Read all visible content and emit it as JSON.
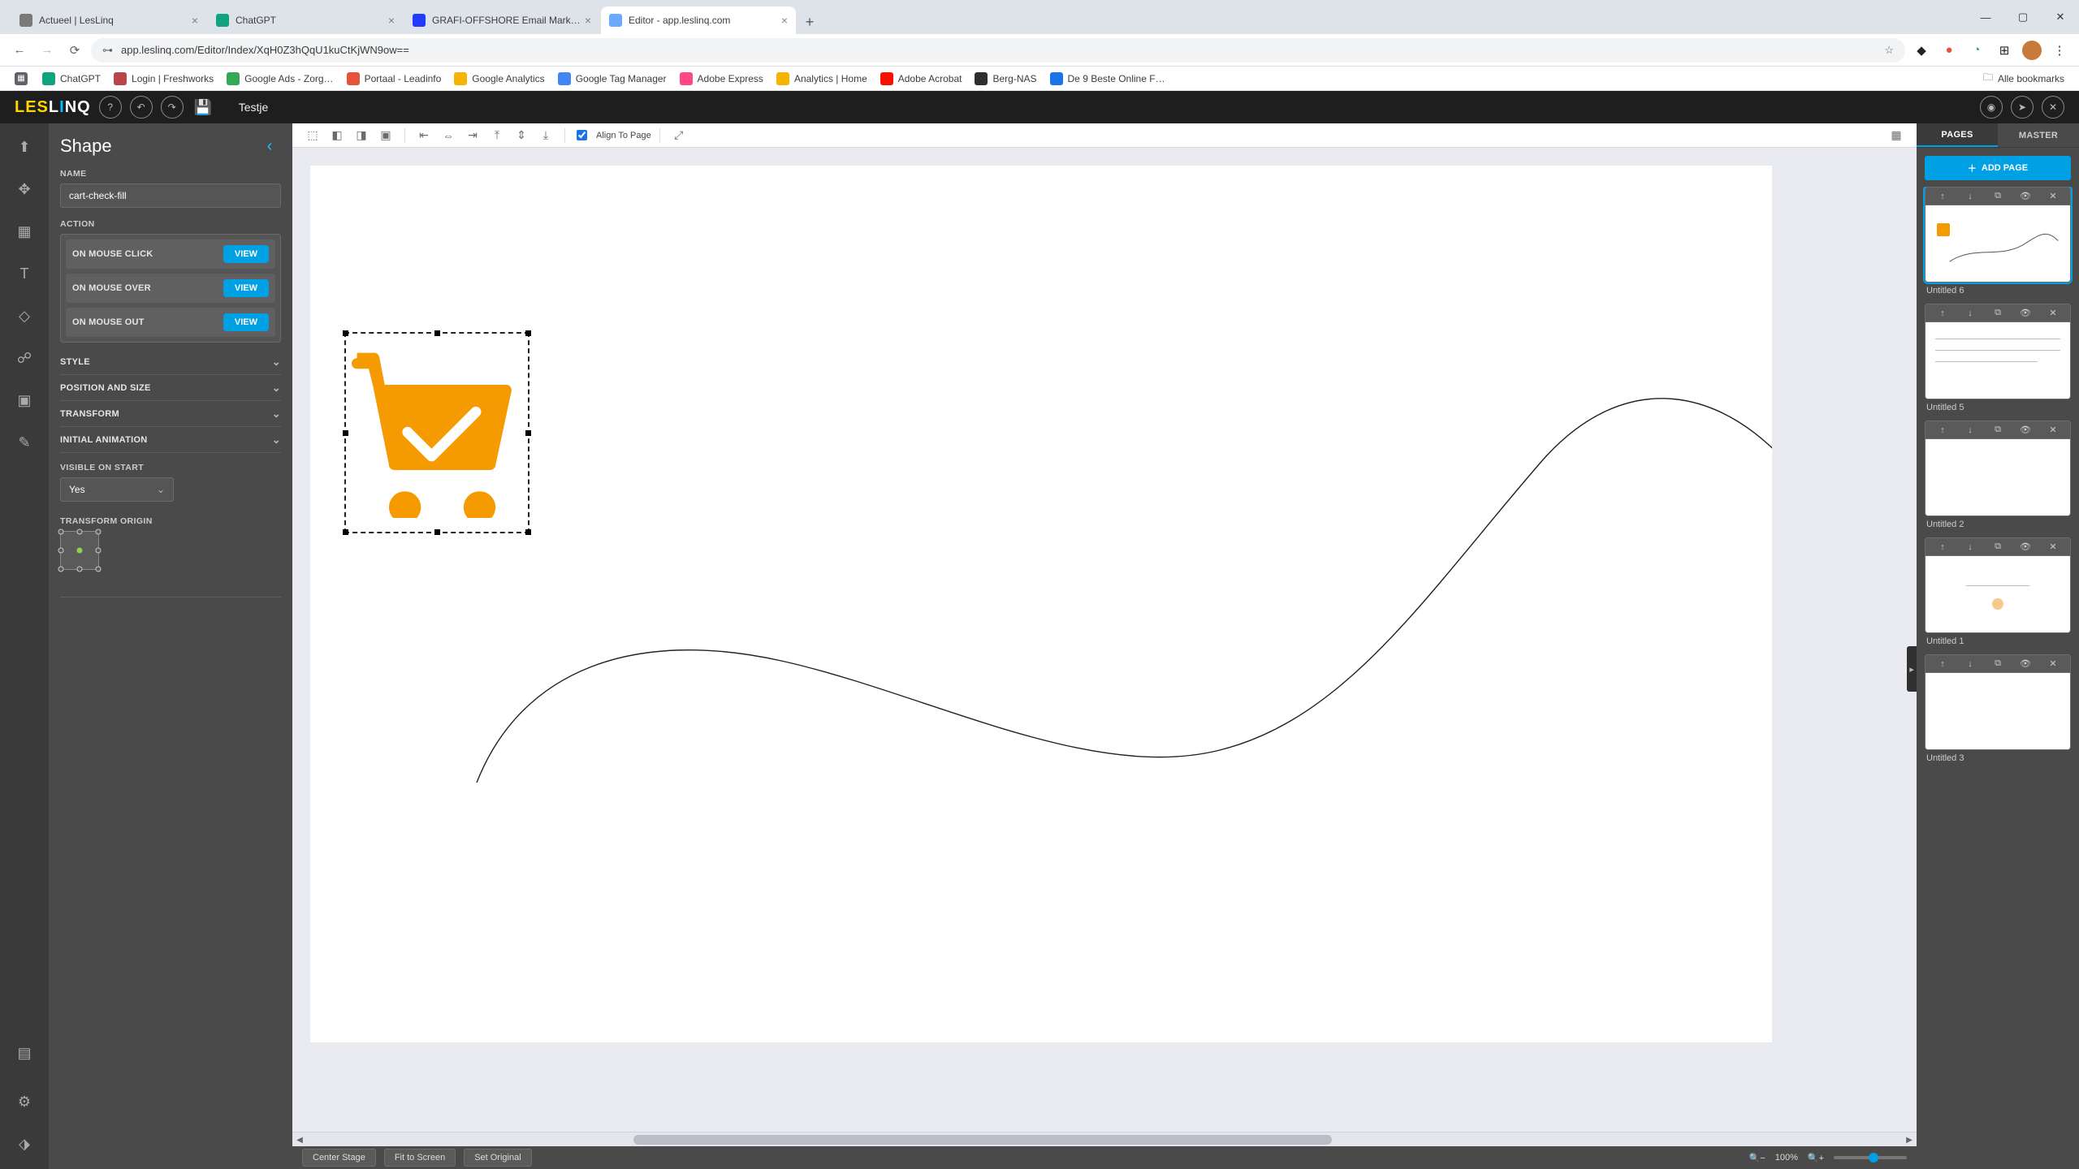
{
  "browser": {
    "tabs": [
      {
        "favicon": "#7a7a7a",
        "title": "Actueel | LesLinq"
      },
      {
        "favicon": "#10a37f",
        "title": "ChatGPT"
      },
      {
        "favicon": "#1f3cff",
        "title": "GRAFI-OFFSHORE Email Mark…"
      },
      {
        "favicon": "#6aa9ff",
        "title": "Editor - app.leslinq.com",
        "active": true
      }
    ],
    "url": "app.leslinq.com/Editor/Index/XqH0Z3hQqU1kuCtKjWN9ow==",
    "bookmarks": [
      {
        "color": "#10a37f",
        "label": "ChatGPT"
      },
      {
        "color": "#b94646",
        "label": "Login | Freshworks"
      },
      {
        "color": "#34a853",
        "label": "Google Ads - Zorg…"
      },
      {
        "color": "#e5533c",
        "label": "Portaal - Leadinfo"
      },
      {
        "color": "#f4b400",
        "label": "Google Analytics"
      },
      {
        "color": "#4285f4",
        "label": "Google Tag Manager"
      },
      {
        "color": "#ff4785",
        "label": "Adobe Express"
      },
      {
        "color": "#f4b400",
        "label": "Analytics | Home"
      },
      {
        "color": "#fa0f00",
        "label": "Adobe Acrobat"
      },
      {
        "color": "#2f2f2f",
        "label": "Berg-NAS"
      },
      {
        "color": "#1a73e8",
        "label": "De 9 Beste Online F…"
      }
    ],
    "bookmarks_right": "Alle bookmarks"
  },
  "app": {
    "title": "Testje",
    "logo_a": "LES",
    "logo_b": "L",
    "logo_c": "I",
    "logo_d": "NQ"
  },
  "inspector": {
    "title": "Shape",
    "name_label": "NAME",
    "name_value": "cart-check-fill",
    "action_label": "ACTION",
    "actions": [
      {
        "label": "ON MOUSE CLICK",
        "btn": "VIEW"
      },
      {
        "label": "ON MOUSE OVER",
        "btn": "VIEW"
      },
      {
        "label": "ON MOUSE OUT",
        "btn": "VIEW"
      }
    ],
    "accordions": [
      "STYLE",
      "POSITION AND SIZE",
      "TRANSFORM",
      "INITIAL ANIMATION"
    ],
    "visible_label": "VISIBLE ON START",
    "visible_value": "Yes",
    "origin_label": "TRANSFORM ORIGIN"
  },
  "ribbon": {
    "align_label": "Align To Page"
  },
  "footer": {
    "center": "Center Stage",
    "fit": "Fit to Screen",
    "original": "Set Original",
    "zoom_pct": "100%"
  },
  "right": {
    "tab_pages": "PAGES",
    "tab_master": "MASTER",
    "add_page": "ADD PAGE",
    "pages": [
      {
        "name": "Untitled 6",
        "sel": true,
        "thumb": "cart"
      },
      {
        "name": "Untitled 5",
        "thumb": "lines"
      },
      {
        "name": "Untitled 2",
        "thumb": "blank"
      },
      {
        "name": "Untitled 1",
        "thumb": "dot"
      },
      {
        "name": "Untitled 3",
        "thumb": "blank"
      }
    ]
  },
  "colors": {
    "accent": "#00a0e4",
    "cart": "#f59a00"
  }
}
